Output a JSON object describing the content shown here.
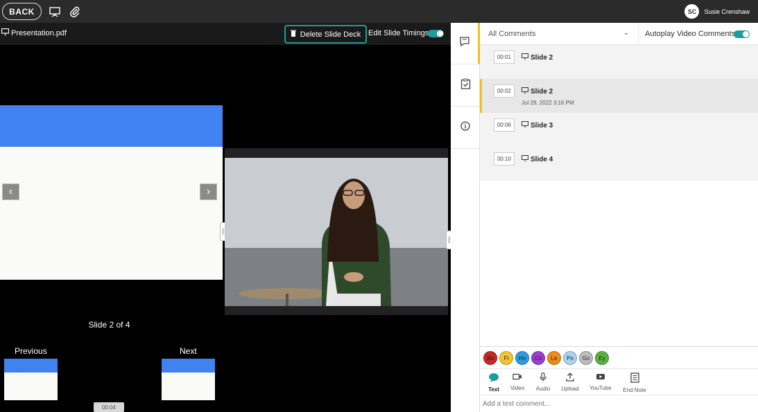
{
  "topbar": {
    "back_label": "BACK",
    "user_initials": "SC",
    "user_name": "Susie Crenshaw"
  },
  "stage": {
    "file_name": "Presentation.pdf",
    "delete_label": "Delete Slide Deck",
    "timing_label": "Edit Slide Timings",
    "slide_counter": "Slide 2 of 4",
    "previous_label": "Previous",
    "next_label": "Next",
    "time_badge": "00:04"
  },
  "panel": {
    "filter_label": "All Comments",
    "autoplay_label": "Autoplay Video Comments",
    "comments": [
      {
        "time": "00:01",
        "title": "Slide 2",
        "date": ""
      },
      {
        "time": "00:02",
        "title": "Slide 2",
        "date": "Jul 29, 2022 3:16 PM"
      },
      {
        "time": "00:06",
        "title": "Slide 3",
        "date": ""
      },
      {
        "time": "00:10",
        "title": "Slide 4",
        "date": ""
      }
    ],
    "chips": [
      {
        "label": "Bo",
        "color": "#c62828"
      },
      {
        "label": "Fi",
        "color": "#f4c430"
      },
      {
        "label": "Ho",
        "color": "#2f9be0"
      },
      {
        "label": "Co",
        "color": "#9c3fd0"
      },
      {
        "label": "Le",
        "color": "#f08a1c"
      },
      {
        "label": "Po",
        "color": "#a8d4f0"
      },
      {
        "label": "Go",
        "color": "#bdbdbd"
      },
      {
        "label": "Ey",
        "color": "#5bb040"
      }
    ],
    "tools": [
      "Text",
      "Video",
      "Audio",
      "Upload",
      "YouTube",
      "End Note"
    ],
    "input_placeholder": "Add a text comment..."
  },
  "colors": {
    "accent_teal": "#1f9c9c",
    "selection_yellow": "#f0c020",
    "slide_blue": "#3f82f0"
  }
}
